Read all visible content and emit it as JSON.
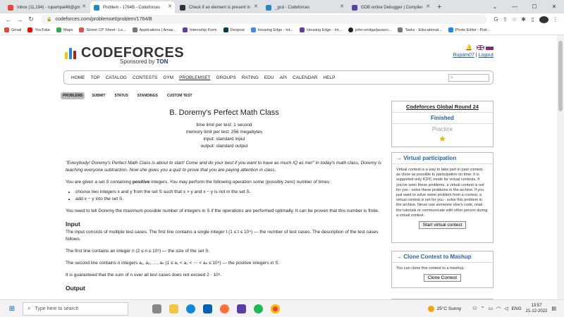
{
  "browser": {
    "tabs": [
      {
        "title": "Inbox (11,194) - rupampal48@gm",
        "color": "#ea4335",
        "active": false
      },
      {
        "title": "Problem - 1764B - Codeforces",
        "color": "#1f8acb",
        "active": true
      },
      {
        "title": "Check if an element is present in",
        "color": "#333333",
        "active": false
      },
      {
        "title": "_gcd - Codeforces",
        "color": "#1f8acb",
        "active": false
      },
      {
        "title": "GDB online Debugger | Compiler",
        "color": "#5a3fa0",
        "active": false
      }
    ],
    "new_tab": "+",
    "url": "codeforces.com/problemset/problem/1764/B",
    "bookmarks": [
      {
        "label": "Gmail",
        "color": "#ea4335"
      },
      {
        "label": "YouTube",
        "color": "#ff0000"
      },
      {
        "label": "Maps",
        "color": "#34a853"
      },
      {
        "label": "Striver CP Sheet : Le...",
        "color": "#d9534f"
      },
      {
        "label": "Applications | Amaz...",
        "color": "#777777"
      },
      {
        "label": "Internship Form",
        "color": "#5a3fa0"
      },
      {
        "label": "Devpost",
        "color": "#003e54"
      },
      {
        "label": "Housing Edge - Int...",
        "color": "#4285f4"
      },
      {
        "label": "Housing Edge - Int...",
        "color": "#5a3fa0"
      },
      {
        "label": "john-smilga/javascr...",
        "color": "#222222"
      },
      {
        "label": "Tasks - Educational...",
        "color": "#777777"
      },
      {
        "label": "Photo Editor : Pixlr...",
        "color": "#1e88e5"
      }
    ]
  },
  "site": {
    "logo_text": "CODEFORCES",
    "sponsor_prefix": "Sponsored by",
    "sponsor_name": "TON",
    "username": "Rupam07",
    "separator": "|",
    "logout": "Logout",
    "menu": [
      "HOME",
      "TOP",
      "CATALOG",
      "CONTESTS",
      "GYM",
      "PROBLEMSET",
      "GROUPS",
      "RATING",
      "EDU",
      "API",
      "CALENDAR",
      "HELP"
    ],
    "subtabs": [
      "PROBLEMS",
      "SUBMIT",
      "STATUS",
      "STANDINGS",
      "CUSTOM TEST"
    ]
  },
  "problem": {
    "title": "B. Doremy's Perfect Math Class",
    "time_limit": "time limit per test: 1 second",
    "memory_limit": "memory limit per test: 256 megabytes",
    "input": "input: standard input",
    "output": "output: standard output",
    "legend": "\"Everybody! Doremy's Perfect Math Class is about to start! Come and do your best if you want to have as much IQ as me!\" In today's math class, Doremy is teaching everyone subtraction. Now she gives you a quiz to prove that you are paying attention in class.",
    "p1_a": "You are given a set ",
    "p1_b": "S",
    "p1_c": " containing ",
    "p1_d": "positive",
    "p1_e": " integers. You may perform the following operation some (possibly zero) number of times:",
    "bullet1": "choose two integers x and y from the set S such that x > y and x − y is not in the set S.",
    "bullet2": "add x − y into the set S.",
    "p2": "You need to tell Doremy the maximum possible number of integers in S if the operations are performed optimally. It can be proven that this number is finite.",
    "input_heading": "Input",
    "in1": "The input consists of multiple test cases. The first line contains a single integer t (1 ≤ t ≤ 10⁴) — the number of test cases. The description of the test cases follows.",
    "in2": "The first line contains an integer n (2 ≤ n ≤ 10⁵) — the size of the set S.",
    "in3": "The second line contains n integers a₁, a₂, …, aₙ (1 ≤ a₁ < a₂ < ⋯ < aₙ ≤ 10⁹) — the positive integers in S.",
    "in4": "It is guaranteed that the sum of n over all test cases does not exceed 2 · 10⁵.",
    "output_heading": "Output"
  },
  "sidebar": {
    "round": "Codeforces Global Round 24",
    "status": "Finished",
    "practice": "Practice",
    "virtual_heading": "→ Virtual participation",
    "virtual_text": "Virtual contest is a way to take part in past contest, as close as possible to participation on time. It is supported only ICPC mode for virtual contests. If you've seen these problems, a virtual contest is not for you - solve these problems in the archive. If you just want to solve some problem from a contest, a virtual contest is not for you - solve this problem in the archive. Never use someone else's code, read the tutorials or communicate with other person during a virtual contest.",
    "virtual_button": "Start virtual contest",
    "clone_heading": "→ Clone Contest to Mashup",
    "clone_text": "You can clone this contest to a mashup.",
    "clone_button": "Clone Contest"
  },
  "taskbar": {
    "search_placeholder": "Type here to search",
    "temperature": "25°C",
    "weather": "Sunny",
    "lang": "ENG",
    "time": "13:57",
    "date": "21-12-2022"
  }
}
